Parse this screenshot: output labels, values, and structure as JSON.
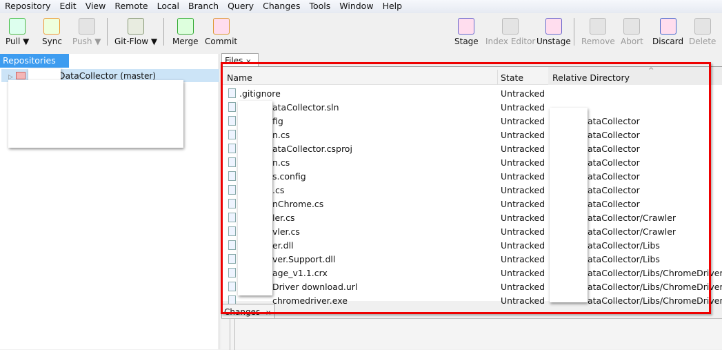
{
  "menu": [
    "Repository",
    "Edit",
    "View",
    "Remote",
    "Local",
    "Branch",
    "Query",
    "Changes",
    "Tools",
    "Window",
    "Help"
  ],
  "toolbar": {
    "pull": "Pull ▼",
    "sync": "Sync",
    "push": "Push ▼",
    "gitflow": "Git-Flow ▼",
    "merge": "Merge",
    "commit": "Commit",
    "stage": "Stage",
    "index_editor": "Index Editor",
    "unstage": "Unstage",
    "remove": "Remove",
    "abort": "Abort",
    "discard": "Discard",
    "delete": "Delete"
  },
  "repositories": {
    "tab": "Repositories",
    "close": "×",
    "item": "DataCollector",
    "branch": "(master)"
  },
  "files": {
    "tab": "Files",
    "close": "×",
    "columns": {
      "name": "Name",
      "state": "State",
      "dir": "Relative Directory"
    },
    "rows": [
      {
        "name": ".gitignore",
        "state": "Untracked",
        "dir": ""
      },
      {
        "name": "ataCollector.sln",
        "state": "Untracked",
        "dir": ""
      },
      {
        "name": "fig",
        "state": "Untracked",
        "dir": "ataCollector"
      },
      {
        "name": "n.cs",
        "state": "Untracked",
        "dir": "ataCollector"
      },
      {
        "name": "ataCollector.csproj",
        "state": "Untracked",
        "dir": "ataCollector"
      },
      {
        "name": "n.cs",
        "state": "Untracked",
        "dir": "ataCollector"
      },
      {
        "name": "s.config",
        "state": "Untracked",
        "dir": "ataCollector"
      },
      {
        "name": ".cs",
        "state": "Untracked",
        "dir": "ataCollector"
      },
      {
        "name": "nChrome.cs",
        "state": "Untracked",
        "dir": "ataCollector"
      },
      {
        "name": "ler.cs",
        "state": "Untracked",
        "dir": "ataCollector/Crawler"
      },
      {
        "name": "vler.cs",
        "state": "Untracked",
        "dir": "ataCollector/Crawler"
      },
      {
        "name": "er.dll",
        "state": "Untracked",
        "dir": "ataCollector/Libs"
      },
      {
        "name": "ver.Support.dll",
        "state": "Untracked",
        "dir": "ataCollector/Libs"
      },
      {
        "name": "age_v1.1.crx",
        "state": "Untracked",
        "dir": "ataCollector/Libs/ChromeDriver"
      },
      {
        "name": "Driver download.url",
        "state": "Untracked",
        "dir": "ataCollector/Libs/ChromeDriver"
      },
      {
        "name": "chromedriver.exe",
        "state": "Untracked",
        "dir": "ataCollector/Libs/ChromeDriver"
      }
    ]
  },
  "changes": {
    "tab": "Changes",
    "close": "×"
  }
}
